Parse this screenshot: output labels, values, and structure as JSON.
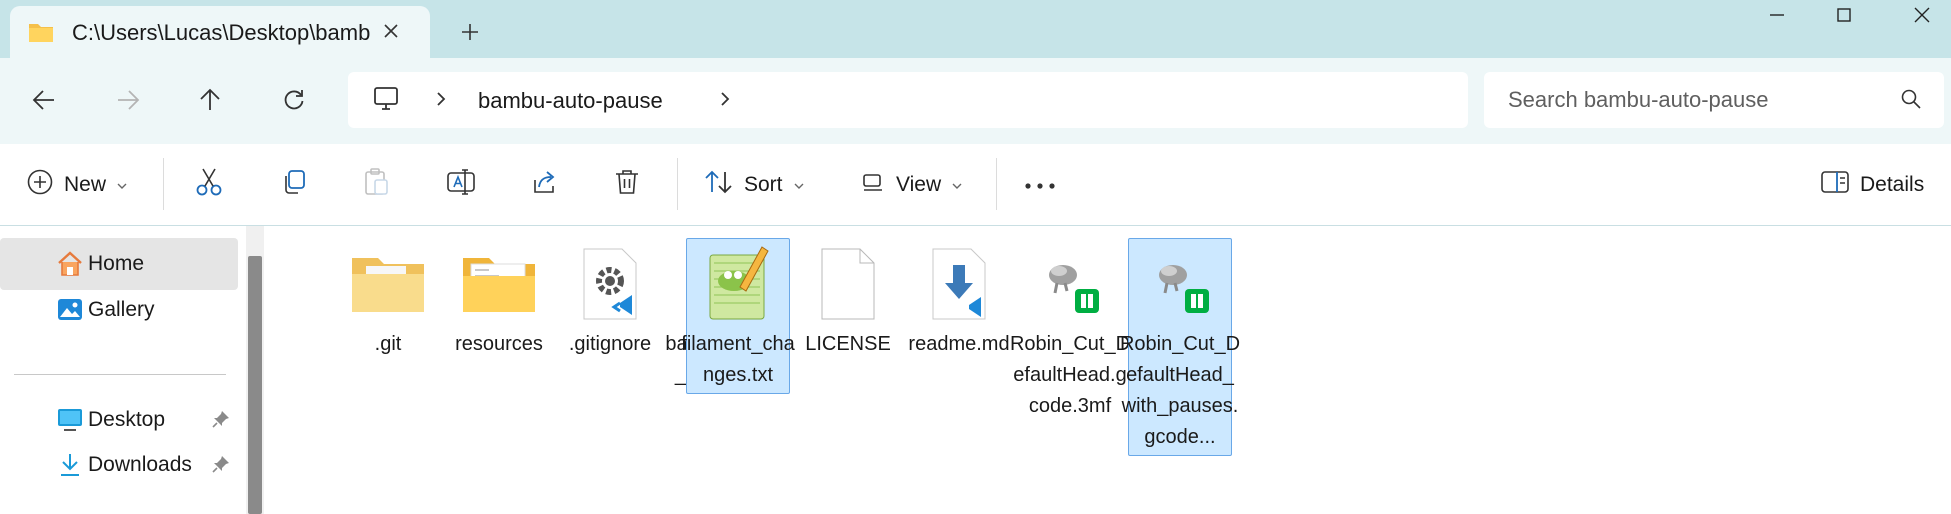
{
  "window": {
    "tab_title": "C:\\Users\\Lucas\\Desktop\\bamb",
    "controls": [
      "minimize",
      "maximize",
      "close"
    ]
  },
  "address": {
    "breadcrumb": "bambu-auto-pause",
    "search_placeholder": "Search bambu-auto-pause"
  },
  "toolbar": {
    "new_label": "New",
    "sort_label": "Sort",
    "view_label": "View",
    "details_label": "Details"
  },
  "sidebar": {
    "items": [
      {
        "label": "Home",
        "icon": "home-icon",
        "selected": true
      },
      {
        "label": "Gallery",
        "icon": "gallery-icon"
      },
      {
        "label": "Desktop",
        "icon": "desktop-icon",
        "pinned": true
      },
      {
        "label": "Downloads",
        "icon": "download-icon",
        "pinned": true
      }
    ]
  },
  "files": [
    {
      "name": ".git",
      "type": "folder"
    },
    {
      "name": "resources",
      "type": "folder"
    },
    {
      "name": ".gitignore",
      "type": "vscode-settings"
    },
    {
      "name": "bambu_auto_pause.py",
      "type": "python"
    },
    {
      "name": "filament_changes.txt",
      "type": "notepad-plus-plus",
      "selected": true
    },
    {
      "name": "LICENSE",
      "type": "blank"
    },
    {
      "name": "readme.md",
      "type": "markdown"
    },
    {
      "name": "Robin_Cut_DefaultHead.gcode.3mf",
      "type": "bambu-3mf"
    },
    {
      "name": "Robin_Cut_DefaultHead_with_pauses.gcode...",
      "type": "bambu-3mf",
      "selected": true
    }
  ],
  "colors": {
    "titlebar": "#c6e4e8",
    "selection": "#cce8ff",
    "selection_border": "#69a8e8",
    "accent": "#005fb8"
  }
}
